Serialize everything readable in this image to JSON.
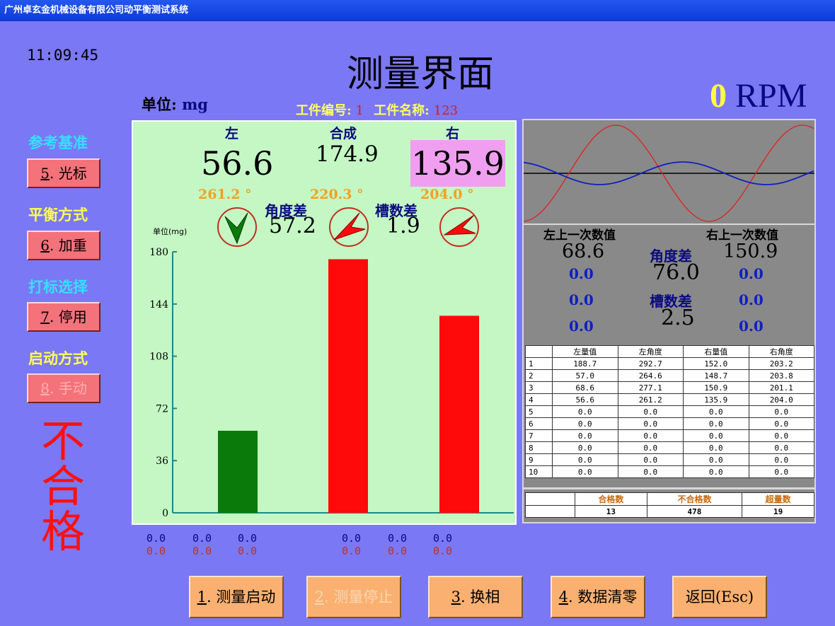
{
  "window": {
    "title": "广州卓玄金机械设备有限公司动平衡测试系统"
  },
  "clock": "11:09:45",
  "page_title": "测量界面",
  "rpm": {
    "value": "0",
    "unit": "RPM"
  },
  "unit_label": {
    "prefix": "单位:",
    "unit": "mg"
  },
  "workpiece": {
    "number_label": "工件编号:",
    "number": "1",
    "name_label": "工件名称:",
    "name": "123"
  },
  "sidebar": {
    "reference_label": "参考基准",
    "reference_btn": {
      "key": "5",
      "text": ". 光标"
    },
    "balance_label": "平衡方式",
    "balance_btn": {
      "key": "6",
      "text": ". 加重"
    },
    "marking_label": "打标选择",
    "marking_btn": {
      "key": "7",
      "text": ". 停用"
    },
    "startup_label": "启动方式",
    "startup_btn": {
      "key": "8",
      "text": ". 手动"
    }
  },
  "status": "不合格",
  "readings": {
    "left_label": "左",
    "combined_label": "合成",
    "right_label": "右",
    "left_value": "56.6",
    "combined_value": "174.9",
    "right_value": "135.9",
    "left_angle": "261.2 °",
    "combined_angle": "220.3 °",
    "right_angle": "204.0 °",
    "angle_diff_label": "角度差",
    "angle_diff_value": "57.2",
    "slot_diff_label": "槽数差",
    "slot_diff_value": "1.9"
  },
  "chart_data": {
    "type": "bar",
    "categories": [
      "左",
      "合成",
      "右"
    ],
    "values": [
      56.6,
      174.9,
      135.9
    ],
    "colors": [
      "#0a7a0a",
      "#ff0a0a",
      "#ff0a0a"
    ],
    "ylabel": "单位(mg)",
    "yticks": [
      "0",
      "36",
      "72",
      "108",
      "144",
      "180"
    ],
    "ylim": [
      0,
      180
    ]
  },
  "bottom_values": {
    "left_top": [
      "0.0",
      "0.0",
      "0.0"
    ],
    "left_bottom": [
      "0.0",
      "0.0",
      "0.0"
    ],
    "right_top": [
      "0.0",
      "0.0",
      "0.0"
    ],
    "right_bottom": [
      "0.0",
      "0.0",
      "0.0"
    ]
  },
  "previous": {
    "left_label": "左上一次数值",
    "right_label": "右上一次数值",
    "left_value": "68.6",
    "right_value": "150.9",
    "angle_diff_label": "角度差",
    "angle_diff_value": "76.0",
    "slot_diff_label": "槽数差",
    "slot_diff_value": "2.5",
    "left_extra": [
      "0.0",
      "0.0",
      "0.0"
    ],
    "right_extra": [
      "0.0",
      "0.0",
      "0.0"
    ]
  },
  "history_table": {
    "headers": [
      "",
      "左量值",
      "左角度",
      "右量值",
      "右角度"
    ],
    "rows": [
      [
        "1",
        "188.7",
        "292.7",
        "152.0",
        "203.2"
      ],
      [
        "2",
        "57.0",
        "264.6",
        "148.7",
        "203.8"
      ],
      [
        "3",
        "68.6",
        "277.1",
        "150.9",
        "201.1"
      ],
      [
        "4",
        "56.6",
        "261.2",
        "135.9",
        "204.0"
      ],
      [
        "5",
        "0.0",
        "0.0",
        "0.0",
        "0.0"
      ],
      [
        "6",
        "0.0",
        "0.0",
        "0.0",
        "0.0"
      ],
      [
        "7",
        "0.0",
        "0.0",
        "0.0",
        "0.0"
      ],
      [
        "8",
        "0.0",
        "0.0",
        "0.0",
        "0.0"
      ],
      [
        "9",
        "0.0",
        "0.0",
        "0.0",
        "0.0"
      ],
      [
        "10",
        "0.0",
        "0.0",
        "0.0",
        "0.0"
      ]
    ]
  },
  "count_table": {
    "headers": [
      "",
      "合格数",
      "不合格数",
      "超量数"
    ],
    "values": [
      "",
      "13",
      "478",
      "19"
    ]
  },
  "bottom_buttons": {
    "start": {
      "key": "1",
      "text": ". 测量启动"
    },
    "stop": {
      "key": "2",
      "text": ". 测量停止"
    },
    "phase": {
      "key": "3",
      "text": ". 换相"
    },
    "clear": {
      "key": "4",
      "text": ". 数据清零"
    },
    "back": "返回(Esc)"
  },
  "colors": {
    "background": "#7b78f5",
    "chart_bg": "#c4f7c4",
    "panel_bg": "#898989",
    "fail": "#ff1010"
  }
}
